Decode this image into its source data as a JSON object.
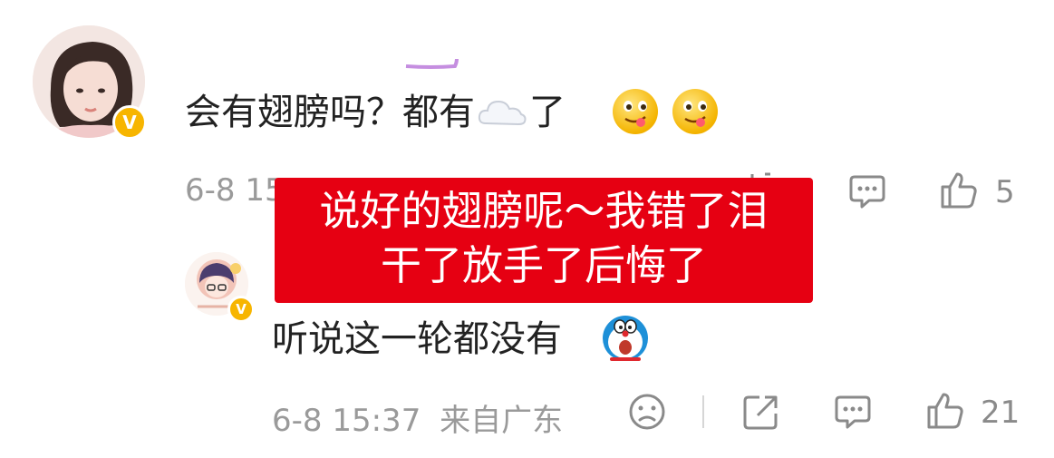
{
  "comment1": {
    "text_before": "会有翅膀吗？都有",
    "cloud_emoji": "cloud-emoji",
    "text_after": "了",
    "emoji": "yum-face-emoji",
    "time_visible": "6-8 15",
    "like_count": "5"
  },
  "overlay": {
    "line1": "说好的翅膀呢～我错了泪",
    "line2": "干了放手了后悔了"
  },
  "comment2": {
    "text": "听说这一轮都没有",
    "emoji": "doraemon-emoji",
    "time": "6-8 15:37",
    "location": "来自广东",
    "like_count": "21"
  },
  "colors": {
    "overlay_bg": "#e60012",
    "verified_badge": "#f7b500",
    "meta_text": "#9a9a9a"
  }
}
